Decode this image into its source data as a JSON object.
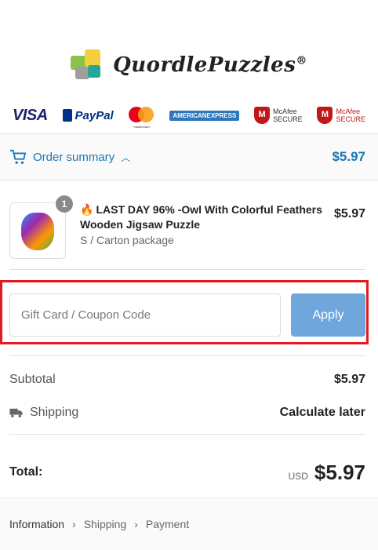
{
  "brand": {
    "name": "QuordlePuzzles",
    "mark": "®"
  },
  "payments": {
    "visa": "VISA",
    "paypal": "PayPal",
    "mastercard": "mastercard",
    "amex": [
      "AMERICAN",
      "EXPRESS"
    ],
    "mcafee1": [
      "McAfee",
      "SECURE"
    ],
    "mcafee2": [
      "McAfee",
      "SECURE"
    ]
  },
  "summary": {
    "toggle_label": "Order summary",
    "total": "$5.97"
  },
  "product": {
    "quantity": "1",
    "name": "LAST DAY 96% -Owl With Colorful Feathers Wooden Jigsaw Puzzle",
    "variant": "S / Carton package",
    "price": "$5.97"
  },
  "coupon": {
    "placeholder": "Gift Card / Coupon Code",
    "apply_label": "Apply"
  },
  "totals": {
    "subtotal_label": "Subtotal",
    "subtotal_value": "$5.97",
    "shipping_label": "Shipping",
    "shipping_value": "Calculate later",
    "total_label": "Total:",
    "currency": "USD",
    "total_value": "$5.97"
  },
  "breadcrumb": [
    "Information",
    "Shipping",
    "Payment"
  ],
  "colors": {
    "accent": "#1877b8",
    "apply_button": "#6fa6dc",
    "highlight": "#e01c22"
  }
}
